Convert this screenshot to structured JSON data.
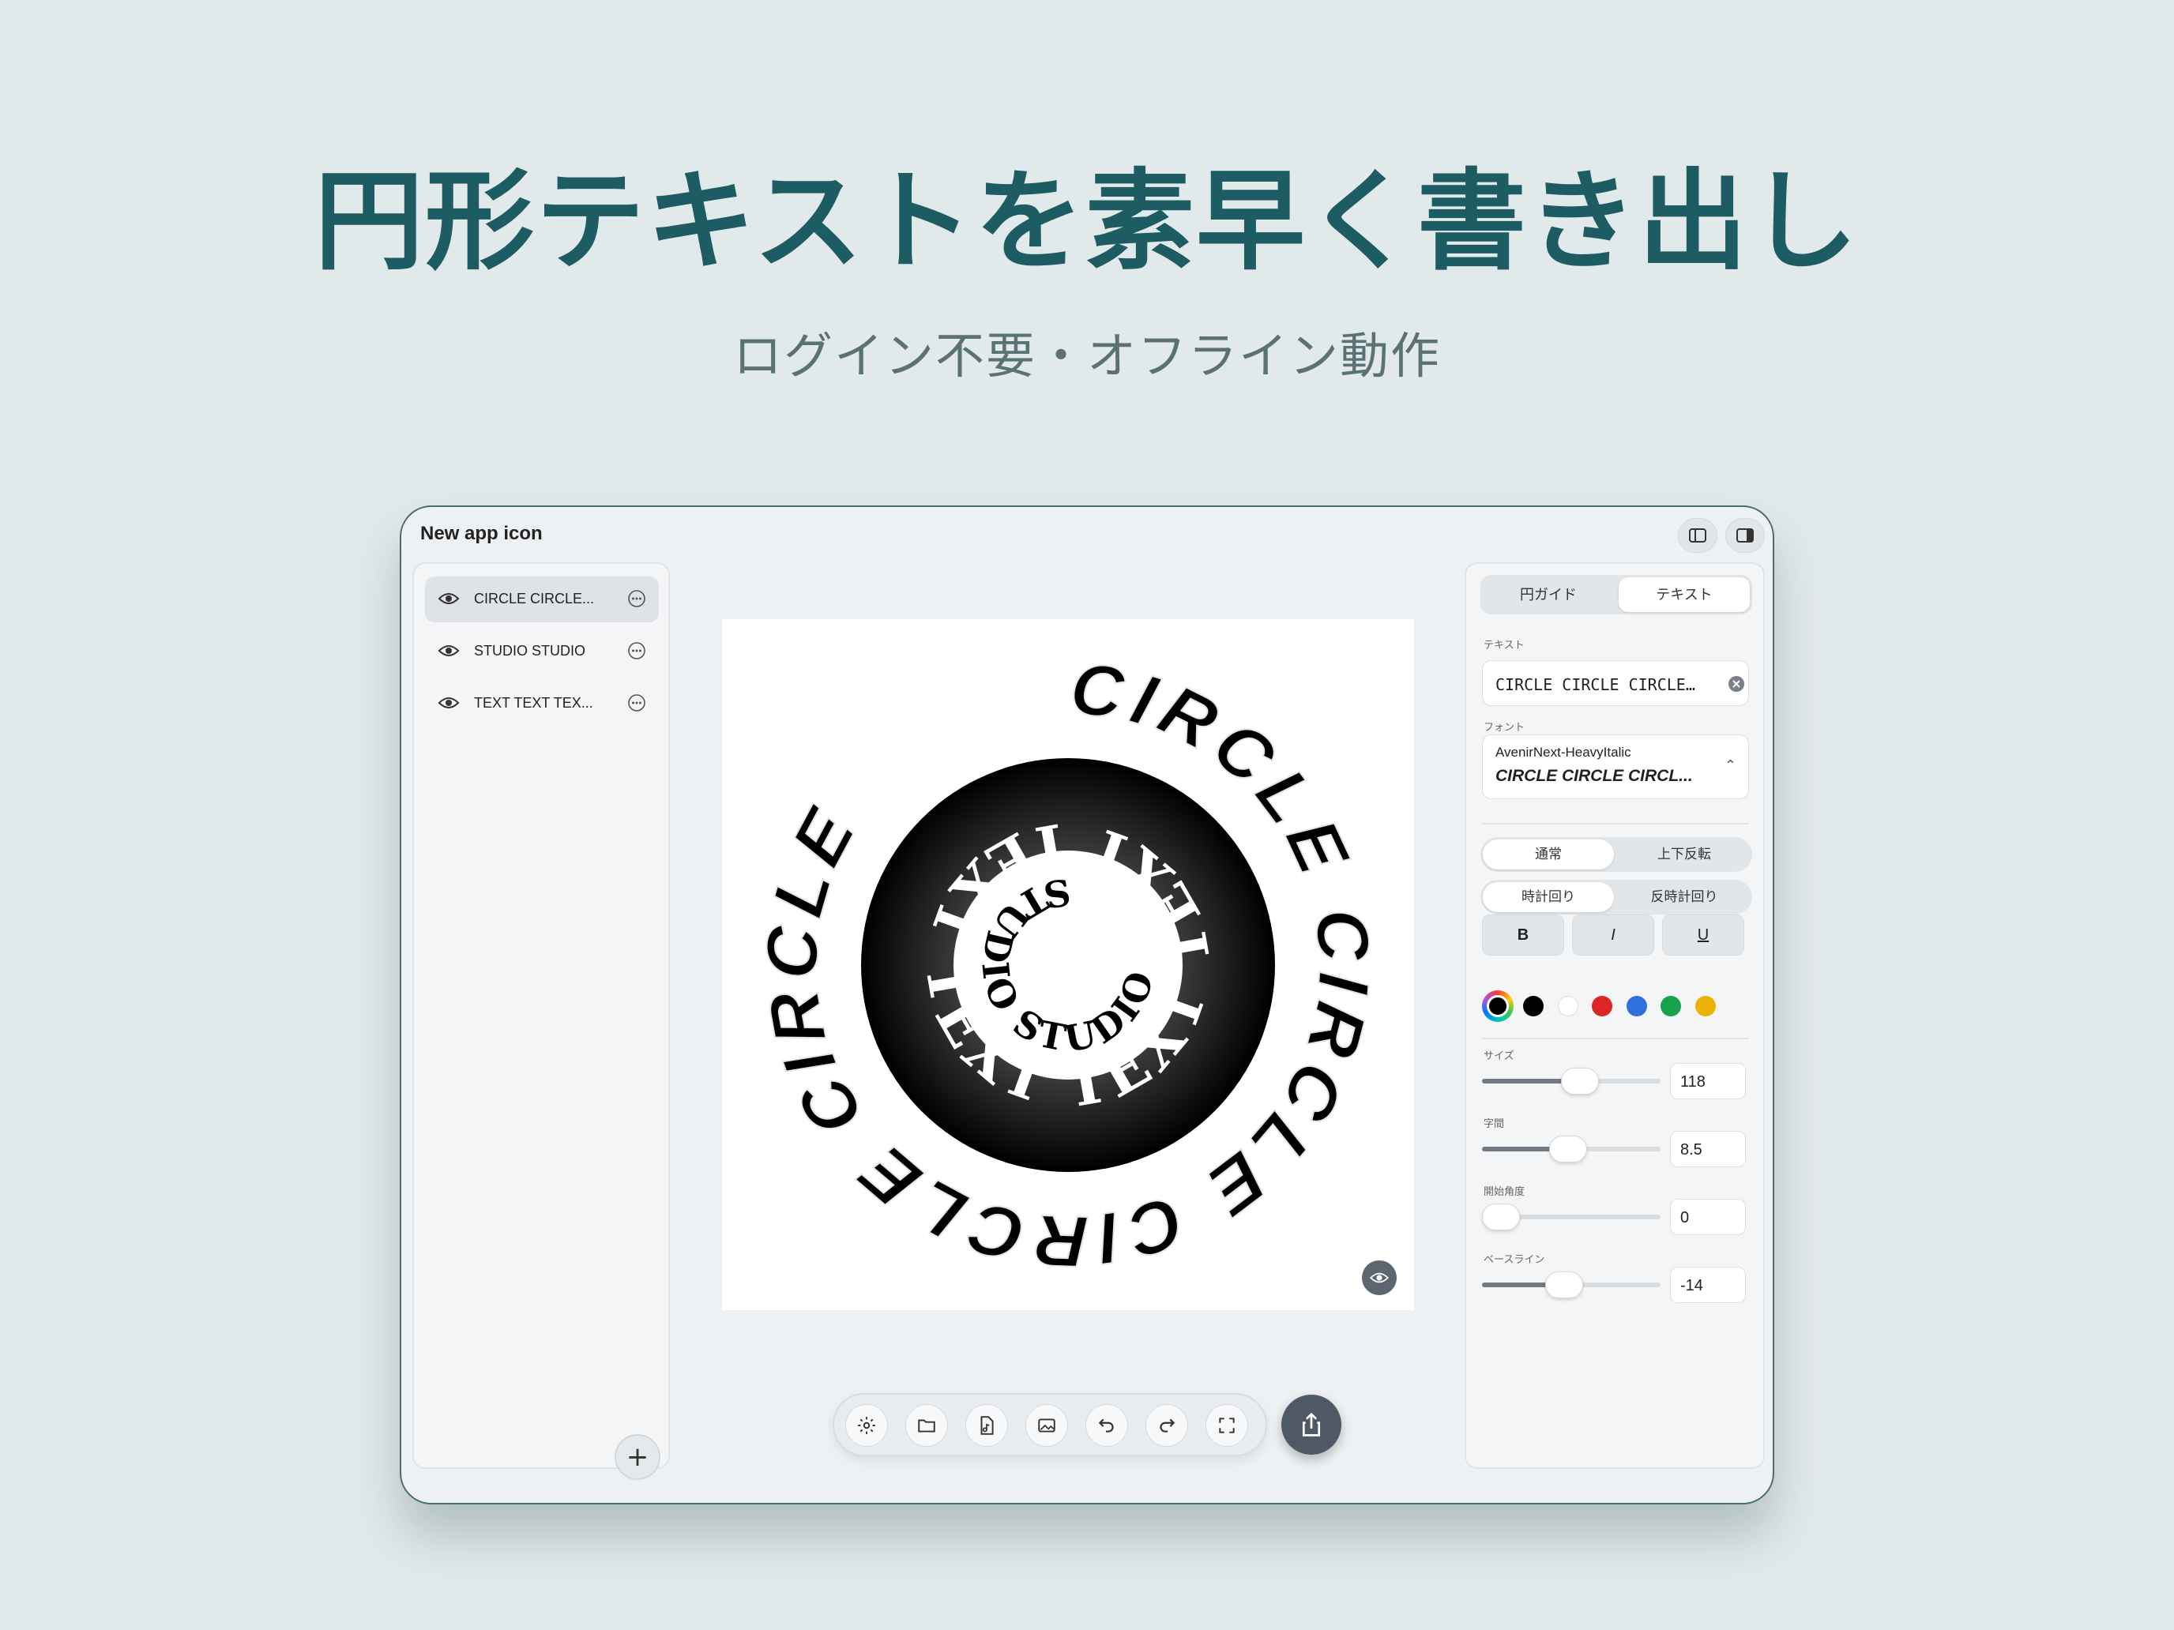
{
  "hero": {
    "title": "円形テキストを素早く書き出し",
    "subtitle": "ログイン不要・オフライン動作"
  },
  "window": {
    "title": "New app icon",
    "toggle_left_icon": "sidebar-left-icon",
    "toggle_right_icon": "sidebar-right-icon"
  },
  "layers": [
    {
      "label": "CIRCLE CIRCLE...",
      "active": true
    },
    {
      "label": "STUDIO STUDIO",
      "active": false
    },
    {
      "label": "TEXT TEXT TEX...",
      "active": false
    }
  ],
  "add_label": "+",
  "canvas": {
    "outer_text": "CIRCLE CIRCLE CIRCLE CIRCLE ",
    "middle_text": "TEXT TEXT TEXT TEXT ",
    "inner_text": "STUDIO STUDIO ",
    "ring_gradient": [
      "#000000",
      "#ffffff"
    ]
  },
  "toolbar": {
    "tools": [
      "gear-icon",
      "folder-icon",
      "file-music-icon",
      "image-icon",
      "undo-icon",
      "redo-icon",
      "fullscreen-icon"
    ],
    "share_icon": "share-icon"
  },
  "inspector": {
    "tabs": [
      "円ガイド",
      "テキスト"
    ],
    "active_tab": 1,
    "text_label": "テキスト",
    "text_value": "CIRCLE CIRCLE CIRCLE…",
    "font_label": "フォント",
    "font_name": "AvenirNext-HeavyItalic",
    "font_sample": "CIRCLE CIRCLE CIRCL...",
    "orientation": [
      "通常",
      "上下反転"
    ],
    "direction": [
      "時計回り",
      "反時計回り"
    ],
    "style_buttons": [
      "B",
      "I",
      "U"
    ],
    "colors": [
      "#000000",
      "#000000",
      "#ffffff",
      "#dc2626",
      "#2f6fde",
      "#16a34a",
      "#eab308"
    ],
    "sliders": [
      {
        "label": "サイズ",
        "value": "118",
        "fraction": 0.56
      },
      {
        "label": "字間",
        "value": "8.5",
        "fraction": 0.48
      },
      {
        "label": "開始角度",
        "value": "0",
        "fraction": 0.0
      },
      {
        "label": "ベースライン",
        "value": "-14",
        "fraction": 0.45
      }
    ]
  }
}
